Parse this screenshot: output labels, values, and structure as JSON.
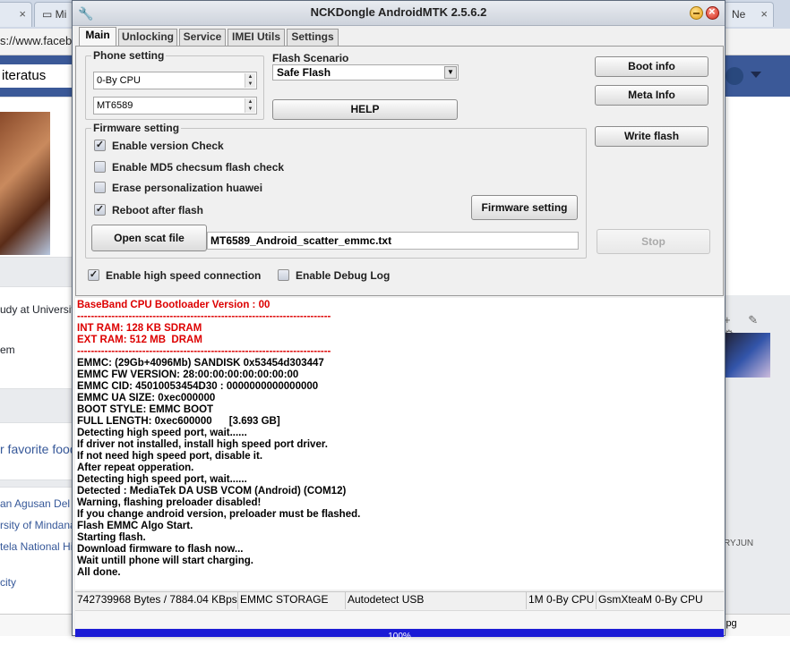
{
  "browser": {
    "tabs": [
      {
        "label": "Mi"
      },
      {
        "label": "Ne"
      }
    ],
    "url": "s://www.faceb",
    "search_text": "iteratus",
    "left_texts": [
      "udy at Universit",
      "em",
      "r favorite food",
      "an Agusan Del S",
      "rsity of Mindana",
      "tela National Hi",
      "city"
    ],
    "right_name": "RYJUN",
    "bottom_item": "ipg"
  },
  "window": {
    "title": "NCKDongle AndroidMTK 2.5.6.2"
  },
  "tabs": [
    {
      "label": "Main"
    },
    {
      "label": "Unlocking"
    },
    {
      "label": "Service"
    },
    {
      "label": "IMEI Utils"
    },
    {
      "label": "Settings"
    }
  ],
  "phone_setting": {
    "label": "Phone setting",
    "cpu": "0-By CPU",
    "chip": "MT6589"
  },
  "flash_scenario": {
    "label": "Flash Scenario",
    "value": "Safe Flash"
  },
  "buttons": {
    "help": "HELP",
    "boot_info": "Boot info",
    "meta_info": "Meta Info",
    "write_flash": "Write flash",
    "firmware_setting": "Firmware setting",
    "open_scat": "Open scat file",
    "stop": "Stop"
  },
  "firmware_setting": {
    "label": "Firmware setting",
    "options": [
      {
        "label": "Enable version Check",
        "checked": true
      },
      {
        "label": "Enable MD5 checsum flash check",
        "checked": false
      },
      {
        "label": "Erase personalization huawei",
        "checked": false
      },
      {
        "label": "Reboot after flash",
        "checked": true
      }
    ],
    "scatter_file": "MT6589_Android_scatter_emmc.txt"
  },
  "connection": {
    "high_speed": {
      "label": "Enable high speed connection",
      "checked": true
    },
    "debug_log": {
      "label": "Enable Debug Log",
      "checked": false
    }
  },
  "log": {
    "lines": [
      {
        "text": "BaseBand CPU Bootloader Version : 00",
        "color": "red"
      },
      {
        "text": "--------------------------------------------------------------------------",
        "color": "red"
      },
      {
        "text": "INT RAM: 128 KB SDRAM",
        "color": "red"
      },
      {
        "text": "EXT RAM: 512 MB  DRAM",
        "color": "red"
      },
      {
        "text": "--------------------------------------------------------------------------",
        "color": "red"
      },
      {
        "text": "EMMC: (29Gb+4096Mb) SANDISK 0x53454d303447",
        "color": "black"
      },
      {
        "text": "EMMC FW VERSION: 28:00:00:00:00:00:00:00",
        "color": "black"
      },
      {
        "text": "EMMC CID: 45010053454D30 : 0000000000000000",
        "color": "black"
      },
      {
        "text": "EMMC UA SIZE: 0xec000000",
        "color": "black"
      },
      {
        "text": "BOOT STYLE: EMMC BOOT",
        "color": "black"
      },
      {
        "text": "FULL LENGTH: 0xec600000      [3.693 GB]",
        "color": "black"
      },
      {
        "text": "Detecting high speed port, wait......",
        "color": "black"
      },
      {
        "text": "If driver not installed, install high speed port driver.",
        "color": "black"
      },
      {
        "text": "If not need high speed port, disable it.",
        "color": "black"
      },
      {
        "text": "After repeat opperation.",
        "color": "black"
      },
      {
        "text": "Detecting high speed port, wait......",
        "color": "black"
      },
      {
        "text": "Detected : MediaTek DA USB VCOM (Android) (COM12)",
        "color": "black"
      },
      {
        "text": "Warning, flashing preloader disabled!",
        "color": "black"
      },
      {
        "text": "If you change android version, preloader must be flashed.",
        "color": "black"
      },
      {
        "text": "Flash EMMC Algo Start.",
        "color": "black"
      },
      {
        "text": "Starting flash.",
        "color": "black"
      },
      {
        "text": "Download firmware to flash now...",
        "color": "black"
      },
      {
        "text": "Wait untill phone will start charging.",
        "color": "black"
      },
      {
        "text": "All done.",
        "color": "black"
      }
    ]
  },
  "status": {
    "bytes": "742739968 Bytes / 7884.04 KBps",
    "storage": "EMMC STORAGE",
    "usb": "Autodetect USB",
    "cpu": "1M 0-By CPU",
    "gsm": "GsmXteaM 0-By CPU"
  },
  "progress": {
    "percent": 1.0,
    "label": "100%"
  }
}
